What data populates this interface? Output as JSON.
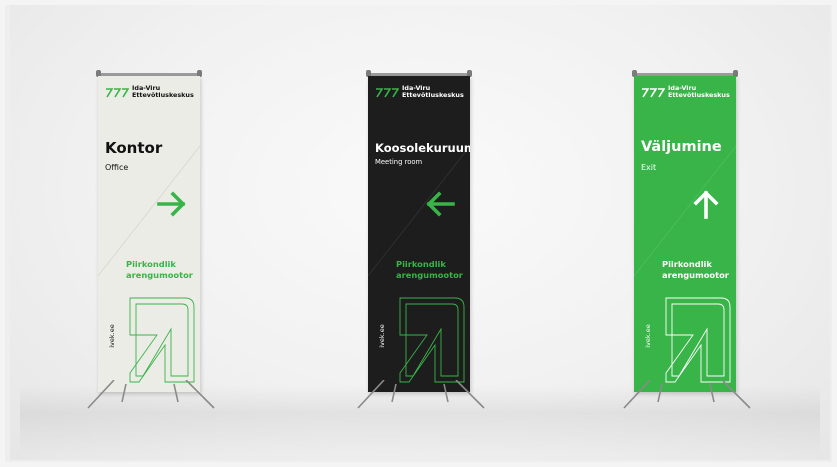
{
  "colors": {
    "brand_green": "#39b449",
    "light_panel": "#ecece6",
    "dark_panel": "#1d1d1d"
  },
  "banners": [
    {
      "variant": "light",
      "logo_line1": "Ida-Viru",
      "logo_line2": "Ettevõtluskeskus",
      "title": "Kontor",
      "subtitle": "Office",
      "arrow_icon": "arrow-right-icon",
      "tagline_line1": "Piirkondlik",
      "tagline_line2": "arengumootor",
      "website": "ivek.ee"
    },
    {
      "variant": "dark",
      "logo_line1": "Ida-Viru",
      "logo_line2": "Ettevõtluskeskus",
      "title": "Koosolekuruum",
      "subtitle": "Meeting room",
      "arrow_icon": "arrow-left-icon",
      "tagline_line1": "Piirkondlik",
      "tagline_line2": "arengumootor",
      "website": "ivek.ee"
    },
    {
      "variant": "green",
      "logo_line1": "Ida-Viru",
      "logo_line2": "Ettevõtluskeskus",
      "title": "Väljumine",
      "subtitle": "Exit",
      "arrow_icon": "arrow-up-icon",
      "tagline_line1": "Piirkondlik",
      "tagline_line2": "arengumootor",
      "website": "ivek.ee"
    }
  ]
}
